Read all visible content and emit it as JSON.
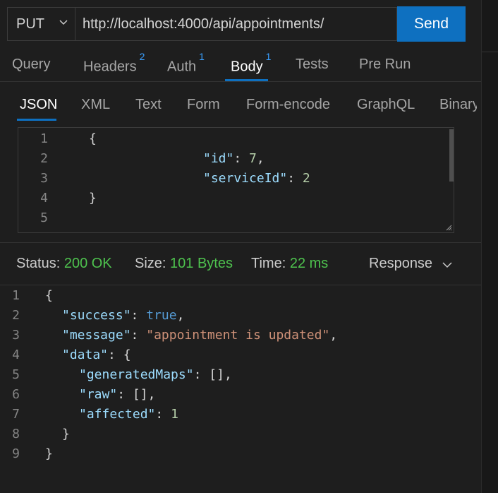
{
  "request": {
    "method": "PUT",
    "url": "http://localhost:4000/api/appointments/",
    "send_label": "Send"
  },
  "tabs": [
    {
      "label": "Query",
      "badge": ""
    },
    {
      "label": "Headers",
      "badge": "2"
    },
    {
      "label": "Auth",
      "badge": "1"
    },
    {
      "label": "Body",
      "badge": "1"
    },
    {
      "label": "Tests",
      "badge": ""
    },
    {
      "label": "Pre Run",
      "badge": ""
    }
  ],
  "active_tab": "Body",
  "body_types": [
    "JSON",
    "XML",
    "Text",
    "Form",
    "Form-encode",
    "GraphQL",
    "Binary"
  ],
  "active_body_type": "JSON",
  "body_editor": {
    "line_numbers": [
      "1",
      "2",
      "3",
      "4",
      "5"
    ],
    "open_brace": "{",
    "id_key": "\"id\"",
    "id_value": "7",
    "serviceId_key": "\"serviceId\"",
    "serviceId_value": "2",
    "close_brace": "}"
  },
  "status": {
    "status_label": "Status:",
    "status_value": "200 OK",
    "size_label": "Size:",
    "size_value": "101 Bytes",
    "time_label": "Time:",
    "time_value": "22 ms",
    "response_select": "Response"
  },
  "response": {
    "line_numbers": [
      "1",
      "2",
      "3",
      "4",
      "5",
      "6",
      "7",
      "8",
      "9"
    ],
    "success_key": "\"success\"",
    "success_value": "true",
    "message_key": "\"message\"",
    "message_value": "\"appointment is updated\"",
    "data_key": "\"data\"",
    "generatedMaps_key": "\"generatedMaps\"",
    "raw_key": "\"raw\"",
    "affected_key": "\"affected\"",
    "affected_value": "1",
    "empty_array": "[]",
    "open_brace": "{",
    "close_brace": "}"
  },
  "colors": {
    "accent": "#0e70c0",
    "success": "#4ec24e",
    "json_key": "#9cdcfe",
    "json_number": "#b5cea8",
    "json_string": "#ce9178",
    "json_bool": "#569cd6"
  },
  "icons": {
    "method_dropdown": "chevron-down-icon",
    "response_dropdown": "chevron-down-icon",
    "editor_resize": "resize-grip-icon"
  }
}
